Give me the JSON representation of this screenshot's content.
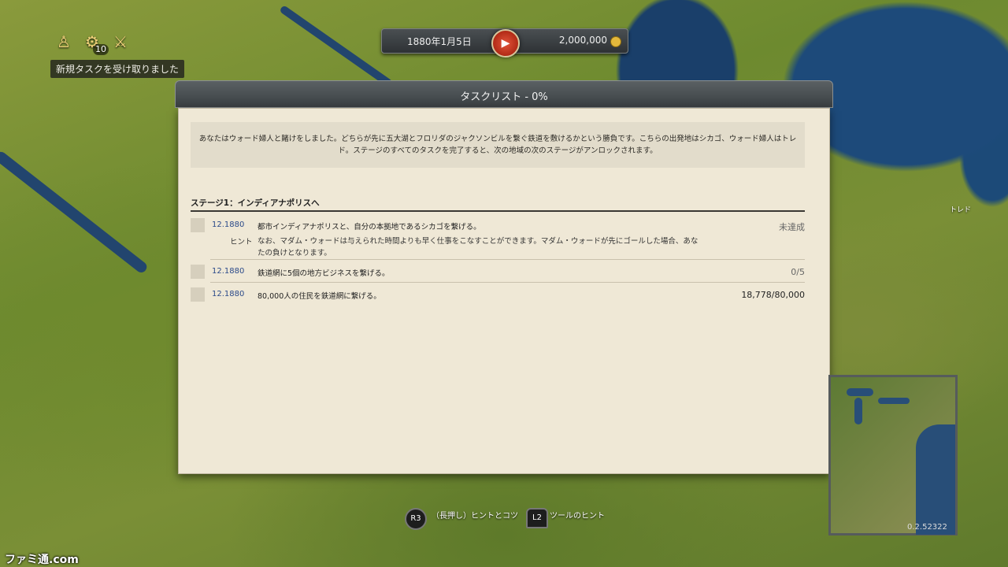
{
  "hud": {
    "icons": [
      {
        "name": "advisor-icon"
      },
      {
        "name": "speed-gauge-icon",
        "badge": "10"
      },
      {
        "name": "task-bottles-icon"
      }
    ],
    "notification": "新規タスクを受け取りました"
  },
  "topbar": {
    "date": "1880年1月5日",
    "money": "2,000,000"
  },
  "task_window": {
    "title": "タスクリスト - 0%",
    "intro": "あなたはウォード婦人と賭けをしました。どちらが先に五大湖とフロリダのジャクソンビルを繋ぐ鉄道を敷けるかという勝負です。こちらの出発地はシカゴ、ウォード婦人はトレド。ステージのすべてのタスクを完了すると、次の地域の次のステージがアンロックされます。",
    "stage_title": "ステージ1：インディアナポリスへ",
    "tasks": [
      {
        "date": "12.1880",
        "desc": "都市インディアナポリスと、自分の本拠地であるシカゴを繋げる。",
        "status": "未達成",
        "hint_label": "ヒント",
        "hint": "なお、マダム・ウォードは与えられた時間よりも早く仕事をこなすことができます。マダム・ウォードが先にゴールした場合、あなたの負けとなります。"
      },
      {
        "date": "12.1880",
        "desc": "鉄道網に5個の地方ビジネスを繋げる。",
        "status": "0/5"
      },
      {
        "date": "12.1880",
        "desc": "80,000人の住民を鉄道網に繋げる。",
        "status": "18,778/80,000"
      }
    ]
  },
  "footer": {
    "r3_label": "R3",
    "r3_text": "（長押し）ヒントとコツ",
    "l2_label": "L2",
    "l2_text": "ツールのヒント"
  },
  "map": {
    "city_label": "トレド"
  },
  "version": "0.2.52322",
  "watermark": "ファミ通.com"
}
